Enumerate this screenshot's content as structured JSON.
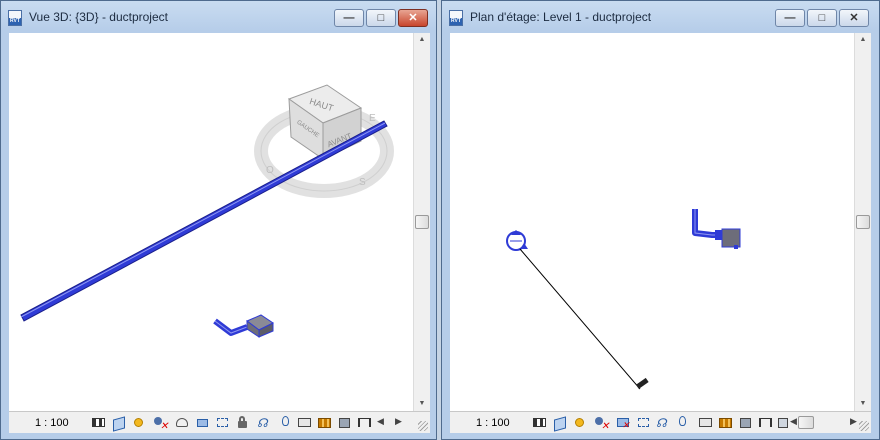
{
  "window1": {
    "title": "Vue 3D: {3D} - ductproject",
    "app_icon_label": "RVT",
    "scale": "1 : 100",
    "viewcube": {
      "top_label": "HAUT",
      "front_label": "AVANT",
      "left_label": "GAUCHE",
      "compass": [
        "S",
        "O",
        "E"
      ]
    }
  },
  "window2": {
    "title": "Plan d'étage: Level 1 - ductproject",
    "app_icon_label": "RVT",
    "scale": "1 : 100"
  },
  "window_buttons": {
    "minimize": "—",
    "maximize": "□",
    "close": "✕"
  },
  "toolbar_icons": [
    "detail-level-icon",
    "visual-style-icon",
    "sun-path-icon",
    "shadows-icon",
    "render-icon",
    "crop-view-icon",
    "show-crop-icon",
    "unlock-3d-icon",
    "temp-hide-icon",
    "reveal-hidden-icon",
    "worksharing-icon",
    "design-options-icon",
    "analysis-icon",
    "highlight-displacement-icon",
    "reveal-constraints-icon"
  ],
  "colors": {
    "duct": "#2f3bd6",
    "duct_dark": "#1a1f8c",
    "equipment": "#6d6d7a",
    "viewcube_face": "#e2e2e2",
    "close_button": "#c8452c"
  }
}
